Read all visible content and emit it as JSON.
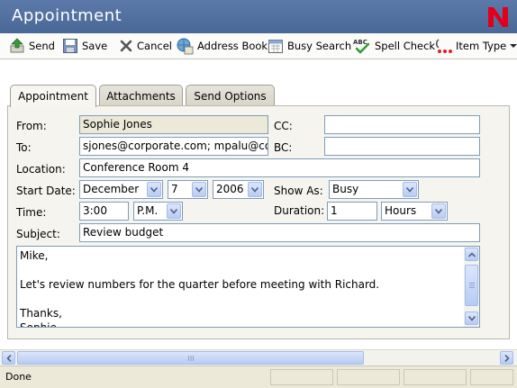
{
  "window": {
    "title": "Appointment"
  },
  "toolbar": {
    "send": "Send",
    "save": "Save",
    "cancel": "Cancel",
    "address_book": "Address Book",
    "busy_search": "Busy Search",
    "spell_check": "Spell Check",
    "item_type": "Item Type"
  },
  "tabs": [
    {
      "label": "Appointment",
      "active": true
    },
    {
      "label": "Attachments",
      "active": false
    },
    {
      "label": "Send Options",
      "active": false
    }
  ],
  "form": {
    "from_label": "From:",
    "from_value": "Sophie Jones",
    "to_label": "To:",
    "to_value": "sjones@corporate.com; mpalu@corporate.com",
    "cc_label": "CC:",
    "cc_value": "",
    "bc_label": "BC:",
    "bc_value": "",
    "location_label": "Location:",
    "location_value": "Conference Room 4",
    "start_date_label": "Start Date:",
    "start_month": "December",
    "start_day": "7",
    "start_year": "2006",
    "show_as_label": "Show As:",
    "show_as_value": "Busy",
    "time_label": "Time:",
    "time_value": "3:00",
    "ampm_value": "P.M.",
    "duration_label": "Duration:",
    "duration_value": "1",
    "duration_unit": "Hours",
    "subject_label": "Subject:",
    "subject_value": "Review budget",
    "message": "Mike,\n\nLet's review numbers for the quarter before meeting with Richard.\n\nThanks,\nSophie"
  },
  "status": {
    "text": "Done"
  },
  "colors": {
    "titlebar": "#4a6897",
    "brand": "#e0001b",
    "field_border": "#7f9db9"
  }
}
